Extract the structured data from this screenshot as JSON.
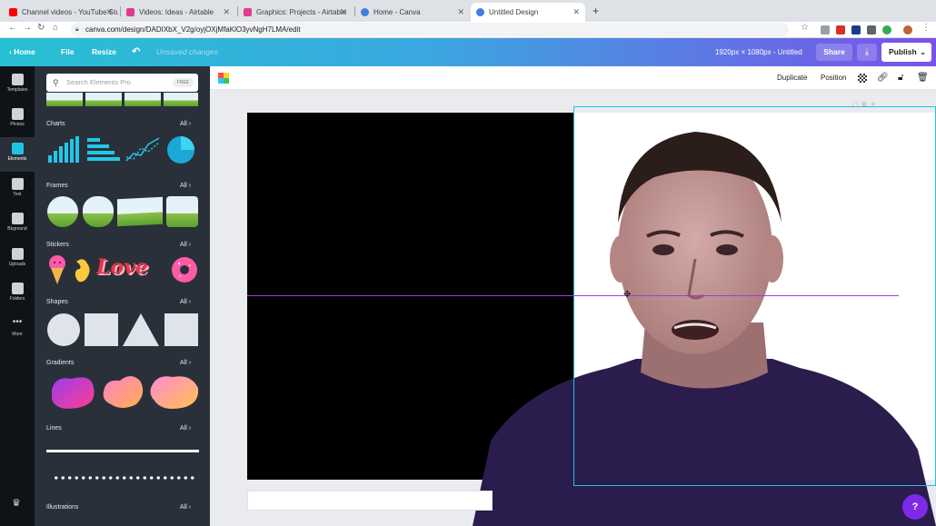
{
  "browser": {
    "tabs": [
      {
        "title": "Channel videos - YouTube Stu",
        "color": "#ff0000"
      },
      {
        "title": "Videos: Ideas - Airtable",
        "color": "#e33b8c"
      },
      {
        "title": "Graphics: Projects - Airtable",
        "color": "#e33b8c"
      },
      {
        "title": "Home - Canva",
        "color": "#3d7fe0"
      },
      {
        "title": "Untitled Design",
        "color": "#3d7fe0"
      }
    ],
    "new_tab": "+",
    "url": "canva.com/design/DADIXbX_V2g/oyjOXjMfaKlO3yvNgH7LMA/edit"
  },
  "header": {
    "home": "Home",
    "file": "File",
    "resize": "Resize",
    "status": "Unsaved changes",
    "dimensions": "1920px × 1080px - Untitled",
    "share": "Share",
    "publish": "Publish"
  },
  "rail": [
    {
      "label": "Templates",
      "active": false
    },
    {
      "label": "Photos",
      "active": false
    },
    {
      "label": "Elements",
      "active": true
    },
    {
      "label": "Text",
      "active": false
    },
    {
      "label": "Bkground",
      "active": false
    },
    {
      "label": "Uploads",
      "active": false
    },
    {
      "label": "Folders",
      "active": false
    },
    {
      "label": "More",
      "active": false
    }
  ],
  "panel": {
    "search_placeholder": "Search Elements Pro",
    "search_badge": "FREE",
    "all": "All",
    "sections": {
      "charts": "Charts",
      "frames": "Frames",
      "stickers": "Stickers",
      "shapes": "Shapes",
      "gradients": "Gradients",
      "lines": "Lines",
      "illustrations": "Illustrations"
    },
    "sticker_text": "Love"
  },
  "toolbar": {
    "duplicate": "Duplicate",
    "position": "Position"
  },
  "help": "?",
  "colors": {
    "accent": "#21c0d9",
    "brand_purple": "#7d2ae8",
    "panel_bg": "#293039",
    "rail_bg": "#0e1318"
  }
}
